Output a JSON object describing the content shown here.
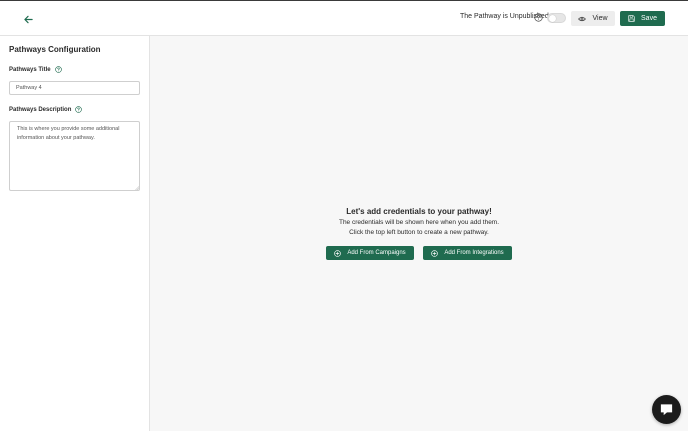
{
  "header": {
    "status_text": "The Pathway is Unpublished",
    "publish_toggle_on": false,
    "view_label": "View",
    "save_label": "Save"
  },
  "sidebar": {
    "title": "Pathways Configuration",
    "title_field": {
      "label": "Pathways Title",
      "value": "Pathway 4"
    },
    "description_field": {
      "label": "Pathways Description",
      "placeholder": "This is where you provide some additional information about your pathway."
    }
  },
  "main": {
    "empty_title": "Let's add credentials to your pathway!",
    "empty_line_1": "The credentials will be shown here when you add them.",
    "empty_line_2": "Click the top left button to create a new pathway.",
    "add_campaigns_label": "Add From Campaigns",
    "add_integrations_label": "Add From Integrations"
  },
  "colors": {
    "primary": "#1f6b4f",
    "chat": "#1c1c1c",
    "canvas": "#f7f7f7"
  },
  "icons": {
    "back": "arrow-left-icon",
    "help": "question-circle-icon",
    "view": "eye-icon",
    "save": "floppy-disk-icon",
    "add": "plus-circle-icon",
    "chat": "chat-bubble-icon"
  }
}
